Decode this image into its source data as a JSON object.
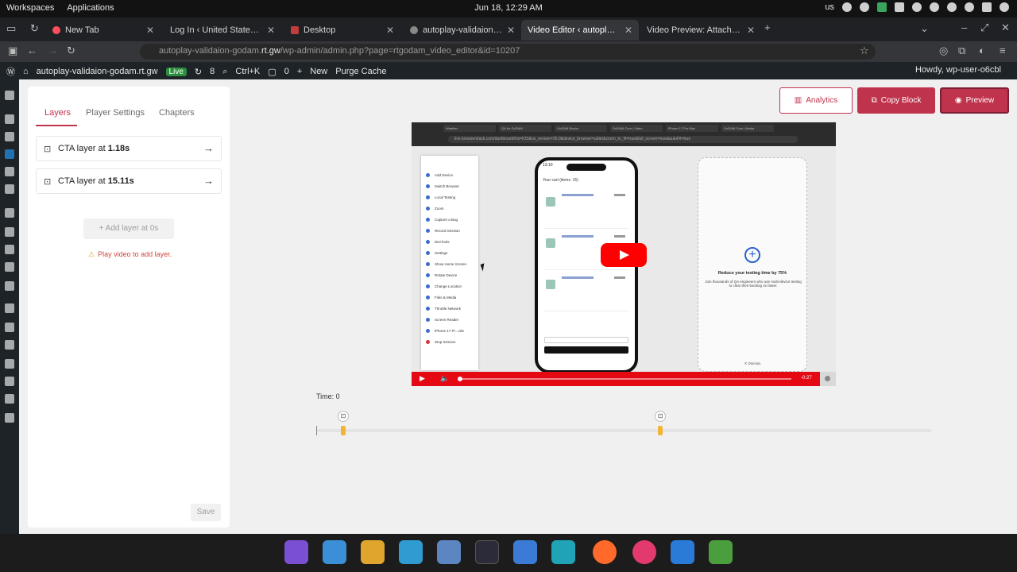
{
  "os": {
    "workspaces": "Workspaces",
    "applications": "Applications",
    "clock": "Jun 18, 12:29 AM",
    "lang": "us"
  },
  "browser": {
    "tabs": [
      {
        "label": "New Tab"
      },
      {
        "label": "Log In ‹ United States —"
      },
      {
        "label": "Desktop"
      },
      {
        "label": "autoplay-validaion-goda"
      },
      {
        "label": "Video Editor ‹ autoplay-vali"
      },
      {
        "label": "Video Preview: Attachment"
      }
    ],
    "url_host": "autoplay-validaion-godam.",
    "url_host_main": "rt.gw",
    "url_path": "/wp-admin/admin.php?page=rtgodam_video_editor&id=10207"
  },
  "wpbar": {
    "site": "autoplay-validaion-godam.rt.gw",
    "live": "Live",
    "updates": "8",
    "search": "Ctrl+K",
    "comments": "0",
    "new": "New",
    "purge": "Purge Cache",
    "howdy": "Howdy, wp-user-o6cbl"
  },
  "editor": {
    "tabs": [
      "Layers",
      "Player Settings",
      "Chapters"
    ],
    "layers": [
      {
        "prefix": "CTA layer at ",
        "time": "1.18s"
      },
      {
        "prefix": "CTA layer at ",
        "time": "15.11s"
      }
    ],
    "add_layer": "Add layer at 0s",
    "warning": "Play video to add layer.",
    "save": "Save",
    "buttons": {
      "analytics": "Analytics",
      "copy_block": "Copy Block",
      "preview": "Preview"
    },
    "time_label": "Time: 0"
  },
  "video": {
    "url": "live.browserstack.com/dashboard#os=iOS&os_version=26.0&device_browser=safari&zoom_to_fit=true&full_screen=true&autoFit=true",
    "tabs": [
      "Weather",
      "QA for GoDAM",
      "GoDAM Blocks",
      "GoDAM Core | Video",
      "iPhone 17 Pro Max",
      "GoDAM Core | Media"
    ],
    "menu_items": [
      "Add Device",
      "Switch Browser",
      "Local Testing",
      "Zoom",
      "Capture a Bug",
      "Record Session",
      "DevTools",
      "Settings",
      "Show Home Screen",
      "Rotate Device",
      "Change Location",
      "Files & Media",
      "Throttle Network",
      "Screen Reader",
      "iPhone 17 Pr...v26",
      "Stop Session"
    ],
    "phone_time": "13:10",
    "phone_title": "Your cart (items: 15)",
    "ad_headline": "Reduce your testing time by 75%",
    "ad_sub": "Join thousands of QA engineers who use multi-device testing to clear their backlog 4x faster.",
    "ad_dismiss": "✕ Dismiss",
    "time_remaining": "-0:27",
    "progress": 0.0
  },
  "timeline": {
    "markers_seconds": [
      1.18,
      15.11
    ]
  }
}
